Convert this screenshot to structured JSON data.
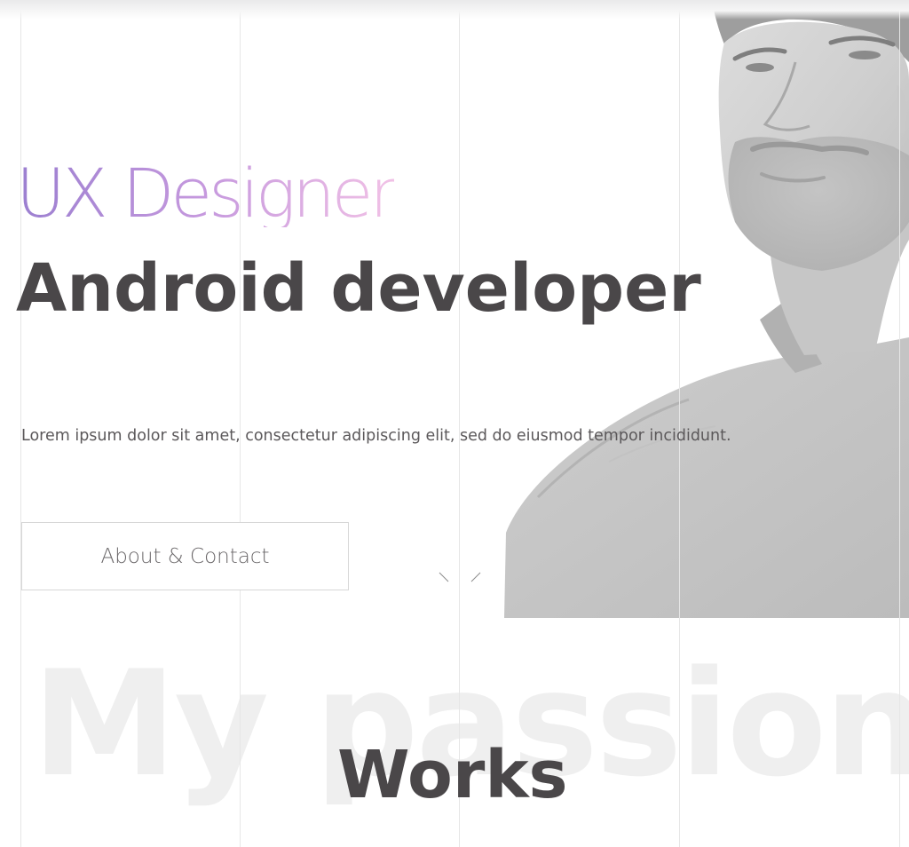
{
  "hero": {
    "subtitle": "UX Designer",
    "headline": "Android developer",
    "intro": "Lorem ipsum dolor sit amet, consectetur adipiscing elit, sed do eiusmod tempor incididunt.",
    "cta_label": "About & Contact",
    "scroll_icon": "chevron-down-icon",
    "portrait_icon": "portrait-photo"
  },
  "works": {
    "background_word": "My passion",
    "title": "Works"
  },
  "colors": {
    "heading": "#4a4749",
    "body_text": "#5b585a",
    "subtitle_gradient_start": "#9b7fd0",
    "subtitle_gradient_end": "#f1c1e6",
    "grid_line": "#e6e6e6",
    "background_word": "#efefef"
  }
}
